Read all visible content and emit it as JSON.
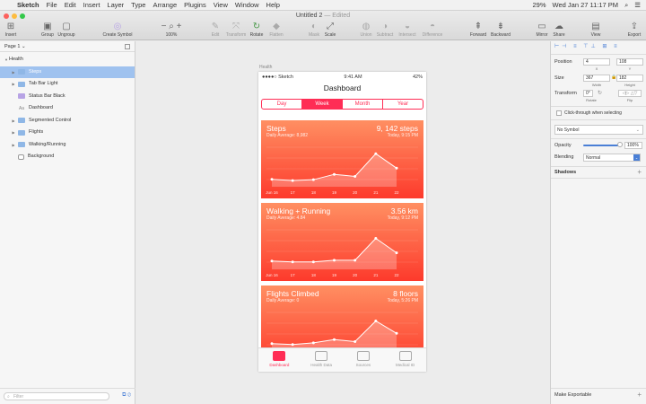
{
  "menubar": {
    "apple": "",
    "app_name": "Sketch",
    "menus": [
      "File",
      "Edit",
      "Insert",
      "Layer",
      "Type",
      "Arrange",
      "Plugins",
      "View",
      "Window",
      "Help"
    ],
    "battery": "29%",
    "datetime": "Wed Jan 27  11:17 PM"
  },
  "document": {
    "title": "Untitled 2",
    "edited": "— Edited"
  },
  "toolbar": {
    "insert": "Insert",
    "group": "Group",
    "ungroup": "Ungroup",
    "create_symbol": "Create Symbol",
    "zoom_value": "100%",
    "edit": "Edit",
    "transform": "Transform",
    "rotate": "Rotate",
    "flatten": "Flatten",
    "mask": "Mask",
    "scale": "Scale",
    "union": "Union",
    "subtract": "Subtract",
    "intersect": "Intersect",
    "difference": "Difference",
    "forward": "Forward",
    "backward": "Backward",
    "mirror": "Mirror",
    "share": "Share",
    "view": "View",
    "export": "Export"
  },
  "pages": {
    "current": "Page 1"
  },
  "layers": [
    {
      "name": "Health",
      "kind": "artboard",
      "level": 0
    },
    {
      "name": "Steps",
      "kind": "group",
      "level": 1,
      "selected": true
    },
    {
      "name": "Tab Bar Light",
      "kind": "group",
      "level": 1
    },
    {
      "name": "Status Bar Black",
      "kind": "symbol",
      "level": 1
    },
    {
      "name": "Dashboard",
      "kind": "text",
      "level": 1
    },
    {
      "name": "Segmented Control",
      "kind": "group",
      "level": 1
    },
    {
      "name": "Flights",
      "kind": "group",
      "level": 1
    },
    {
      "name": "Walking/Running",
      "kind": "group",
      "level": 1
    },
    {
      "name": "Background",
      "kind": "shape",
      "level": 1
    }
  ],
  "filter_placeholder": "Filter",
  "artboard": {
    "name": "Health",
    "status": {
      "carrier": "●●●●○ Sketch",
      "time": "9:41 AM",
      "battery": "42%"
    },
    "title": "Dashboard",
    "segments": [
      "Day",
      "Week",
      "Month",
      "Year"
    ],
    "active_segment": "Week",
    "cards": [
      {
        "title": "Steps",
        "value": "9, 142 steps",
        "sub": "Daily Average: 8,982",
        "right": "Today, 9:15 PM",
        "labels": [
          "Jun 16",
          "17",
          "18",
          "19",
          "20",
          "21",
          "22"
        ],
        "points": [
          0.18,
          0.15,
          0.17,
          0.3,
          0.25,
          0.8,
          0.45
        ]
      },
      {
        "title": "Walking + Running",
        "value": "3.56 km",
        "sub": "Daily Average: 4.84",
        "right": "Today, 9:12 PM",
        "labels": [
          "Jun 16",
          "17",
          "18",
          "19",
          "20",
          "21",
          "22"
        ],
        "points": [
          0.2,
          0.18,
          0.18,
          0.22,
          0.22,
          0.75,
          0.4
        ]
      },
      {
        "title": "Flights Climbed",
        "value": "8 floors",
        "sub": "Daily Average: 0",
        "right": "Today, 5:26 PM",
        "labels": [],
        "points": [
          0.2,
          0.18,
          0.22,
          0.3,
          0.25,
          0.75,
          0.45
        ]
      }
    ],
    "tabs": [
      "Dashboard",
      "Health Data",
      "Sources",
      "Medical ID"
    ],
    "active_tab": "Dashboard"
  },
  "inspector": {
    "position_label": "Position",
    "x": "4",
    "y": "108",
    "x_sub": "X",
    "y_sub": "Y",
    "size_label": "Size",
    "width": "367",
    "height": "182",
    "w_sub": "Width",
    "h_sub": "Height",
    "transform_label": "Transform",
    "rotation": "0°",
    "rotate_sub": "Rotate",
    "flip_sub": "Flip",
    "clickthrough": "Click-through when selecting",
    "symbol": "No Symbol",
    "opacity_label": "Opacity",
    "opacity": "100%",
    "blending_label": "Blending",
    "blending": "Normal",
    "shadows_label": "Shadows",
    "make_exportable": "Make Exportable"
  },
  "colors": {
    "accent": "#ff2d55",
    "selection": "#9fc2ef",
    "card_top": "#ff8f62",
    "card_bottom": "#fd3a2c"
  }
}
